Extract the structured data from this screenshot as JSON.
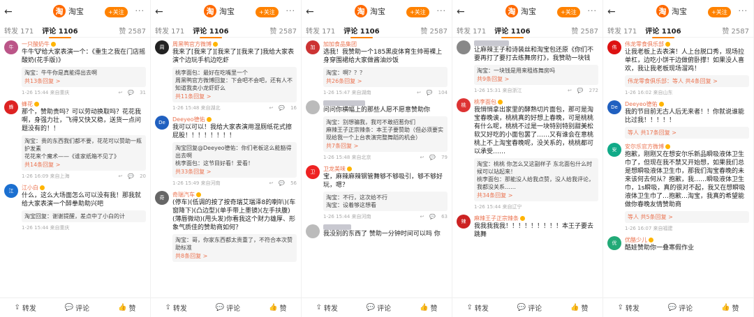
{
  "app": {
    "back": "←",
    "brand": "淘宝",
    "logo": "淘",
    "follow": "+关注",
    "more": "···"
  },
  "tabs": {
    "zhuanfa": "转发 171",
    "pinglun": "评论 1106",
    "zan": "赞 2587"
  },
  "footer": {
    "zhuanfa": "转发",
    "pinglun": "评论",
    "zan": "赞"
  },
  "panels": [
    {
      "comments": [
        {
          "name": "一只酸奶牛",
          "avatar_color": "#b58",
          "text": "牛牛🐮给大家表演一个：《重生之我在门店摇酸奶(花手版)》",
          "reply": "淘宝：牛牛你是真能得出去啊",
          "reply_more": "共13条回复 >",
          "meta": "1-26 15:44 来自重庆",
          "likes": "31"
        },
        {
          "name": "蜂花",
          "avatar_color": "#d22",
          "text": "那个，赞助贵吗？可以劳动换取吗？花花我啊，身强力壮，飞得又快又稳，送货一点问题没有的！！",
          "reply": "淘宝：贵的东西我们都不要，花花可以赞助一瓶护发素",
          "reply2": "花花来个魔术——《谁家纸箱不见了》",
          "reply_more": "共14条回复 >",
          "meta": "1-26 16:09 来自上海",
          "likes": "20"
        },
        {
          "name": "江小白",
          "avatar_color": "#1b6fd0",
          "text": "什么，这么大场面怎么可以没有我！那我就给大家表演一个醉拳助助兴吧",
          "reply": "淘宝回复：谢谢提醒，差点中了小白的计",
          "reply_more": "",
          "meta": "1-26 15:44 来自重庆",
          "likes": ""
        }
      ]
    },
    {
      "comments": [
        {
          "name": "周黑鸭官方微博",
          "avatar_color": "#222",
          "text": "我来了[我来了][我来了][我来了]我给大家表演个边玩手机边吃虾",
          "reply": "桃李面包：最好在吃嘴里一个",
          "reply2": "周黑鸭官方微博回复：下会吧不会吧，还有人不知道我卖小龙虾虾么",
          "reply_more": "共11条回复 >",
          "meta": "1-26 15:48 来自湖北",
          "likes": "16"
        },
        {
          "name": "Deeyeo德佑",
          "avatar_color": "#2060c0",
          "text": "我可以可以！我给大家表演用湿厕纸花式擦屁股！！！！！！！！",
          "reply": "淘宝回复@Deeyeo德佑：你们老板这么能豁得出去啊",
          "reply2": "桃李面包：这节目好看！爱看！",
          "reply_more": "共33条回复 >",
          "meta": "1-26 15:49 来自河南",
          "likes": "56"
        },
        {
          "name": "奇瑞汽车",
          "avatar_color": "#666",
          "text": "(停车)(低调的按了按奇瑞艾瑞泽8的喇叭)(车窗降下)(凸边型)(单手带上墨镜)(左手扶腹)(薄唇微动)(甩头发)你看我这个财力雄厚、形象气质佳的赞助商如何？",
          "reply": "淘宝：哥，你家东西都太贵重了，不符合本次赞助标准",
          "reply_more": "共8条回复 >",
          "meta": "1-26 15:44 来自安徽",
          "likes": ""
        }
      ]
    },
    {
      "comments": [
        {
          "name": "加加食品集团",
          "avatar_color": "#c33",
          "text": "选我！我赞助一个185黑皮体育生帅哥裸上身穿围裙给大家做酱油炒饭",
          "reply": "淘宝：啊？？？",
          "reply_more": "共26条回复 >",
          "meta": "1-26 15:47 来自湖南",
          "likes": "104"
        },
        {
          "name": "",
          "avatar_color": "#bbb",
          "text": "问问你横幅上的那些人愿不愿意赞助你",
          "reply": "淘宝：别想骗我，我可不敢招惹你们",
          "reply2": "麻辣王子正宗辣条：本王子要赞助（但必须要实现给我一个上台表演完整舞蹈的机会）",
          "reply_more": "共7条回复 >",
          "meta": "1-26 15:48 来自北京",
          "likes": "79"
        },
        {
          "name": "卫龙美味",
          "avatar_color": "#e22",
          "text": "宝，麻辣麻辣钢管舞够不够吸引，够不够好玩，嗯？",
          "reply": "淘宝：不行，这次给不行",
          "reply2": "淘宝：设着够这想看",
          "reply_more": "",
          "meta": "1-26 15:44 来自河南",
          "likes": "63"
        },
        {
          "name": "",
          "avatar_color": "#bbb",
          "text": "我没别的东西了 赞助一分钟时间可以吗 你",
          "reply": "",
          "reply_more": "",
          "meta": "",
          "likes": ""
        }
      ]
    },
    {
      "comments": [
        {
          "name": "",
          "avatar_color": "#888",
          "text": "让麻辣王子和诗装丝和淘宝包还原《你们不要再打了要打去练舞房打》，我赞助一块钱",
          "reply": "淘宝：一块钱是用来租练舞房吗",
          "reply_more": "共9条回复 >",
          "meta": "1-26 15:31 来自浙江",
          "likes": "272"
        },
        {
          "name": "桃李面包",
          "avatar_color": "#d33",
          "text": "我悄悄拿出家里的酵熟切片面包，那可是淘宝春晚诶，桃桃真的好想上春晚，可是桃桃有什么呢，桃桃不过是一块特别特别甜美松软又好吃的小面包罢了……又有谁会在意桃桃上不上淘宝春晚呢，没关系的，桃桃都可以承受……",
          "reply": "淘宝：桃桃 你怎么又这副样子 东北面包什么时候可以站起来！",
          "reply2": "桃李面包：那能没人给我点赞，没人给我评论，我都没关系……",
          "reply_more": "共34条回复 >",
          "meta": "1-26 15:44 来自辽宁",
          "likes": ""
        },
        {
          "name": "麻辣王子正宗辣条",
          "avatar_color": "#c22",
          "text": "我我我我我！！！！！！！！！本王子要去跳舞",
          "reply": "",
          "reply_more": "",
          "meta": "",
          "likes": ""
        }
      ]
    },
    {
      "comments": [
        {
          "name": "伟龙零食俱乐部",
          "avatar_color": "#d11",
          "text": "让我老板上去表演！人上台脱口秀，现场拉单杠，边吃小饼干边做俯卧撑！如果没人喜欢，我让我老板现场溜鸡！",
          "reply": "伟龙零食俱乐部：等人 共4条回复 >",
          "reply_more": "",
          "meta": "1-26 16:02 来自山东",
          "likes": ""
        },
        {
          "name": "Deeyeo德佑",
          "avatar_color": "#2060c0",
          "text": "我的节目前无古人后无来者！！你就说谁能比过我！！！！！",
          "reply": "等人 共17条回复 >",
          "reply_more": "",
          "meta": "",
          "likes": ""
        },
        {
          "name": "安尔乐官方微博",
          "avatar_color": "#1a8",
          "text": "抱歉，刚刚又在想安尔乐新品瞬吸液体卫生巾了，但现在我不禁又开始想，如果我们总是想瞬吸液体卫生巾，那我们淘宝春晚的未来该何去何从？抱歉，我……瞬吸液体卫生巾，1s瞬吸，真的很对不起，我又在想瞬吸液体卫生巾了…抱歉…淘宝，我真的希望能做你春晚友情赞助商",
          "reply": "等人 共5条回复 >",
          "reply_more": "",
          "meta": "1-26 16:07 来自福建",
          "likes": ""
        },
        {
          "name": "优酪少儿",
          "avatar_color": "#2a7",
          "text": "酷娃赞助你一叠寒假作业",
          "reply": "",
          "reply_more": "",
          "meta": "",
          "likes": ""
        }
      ]
    }
  ]
}
